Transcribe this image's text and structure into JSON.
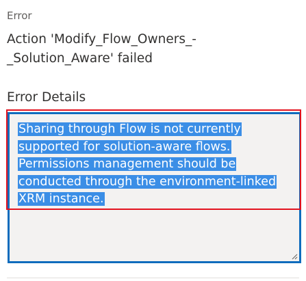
{
  "error_section": {
    "label": "Error",
    "message": "Action 'Modify_Flow_Owners_-_Solution_Aware' failed"
  },
  "details_section": {
    "label": "Error Details",
    "text": "Sharing through Flow is not currently supported for solution-aware flows. Permissions management should be conducted through the environment-linked XRM instance."
  },
  "colors": {
    "focus_border": "#0f6cbd",
    "selection": "#3b8ee6",
    "annotation_box": "#e3121e"
  }
}
